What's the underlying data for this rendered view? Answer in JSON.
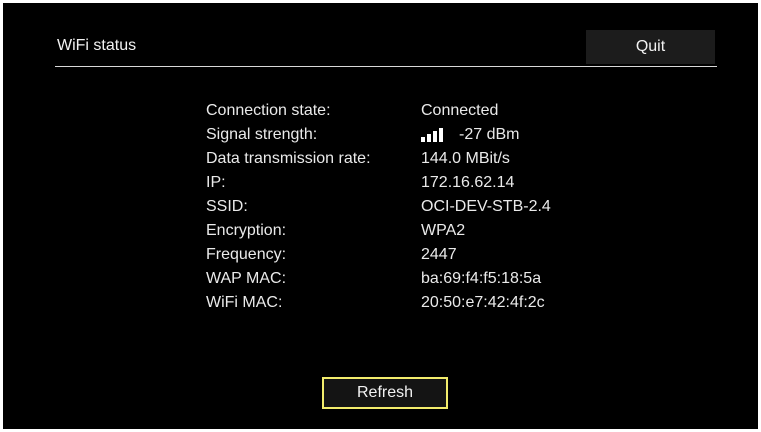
{
  "header": {
    "title": "WiFi status",
    "quit_label": "Quit"
  },
  "status": {
    "rows": [
      {
        "label": "Connection state:",
        "value": "Connected"
      },
      {
        "label": "Signal strength:",
        "value": "-27 dBm",
        "icon": "signal-strength-icon"
      },
      {
        "label": "Data transmission rate:",
        "value": "144.0 MBit/s"
      },
      {
        "label": "IP:",
        "value": "172.16.62.14"
      },
      {
        "label": "SSID:",
        "value": "OCI-DEV-STB-2.4"
      },
      {
        "label": "Encryption:",
        "value": "WPA2"
      },
      {
        "label": "Frequency:",
        "value": "2447"
      },
      {
        "label": "WAP MAC:",
        "value": "ba:69:f4:f5:18:5a"
      },
      {
        "label": "WiFi MAC:",
        "value": "20:50:e7:42:4f:2c"
      }
    ]
  },
  "footer": {
    "refresh_label": "Refresh"
  },
  "colors": {
    "background": "#000000",
    "text": "#ececec",
    "focus_border": "#f2ec6c"
  }
}
